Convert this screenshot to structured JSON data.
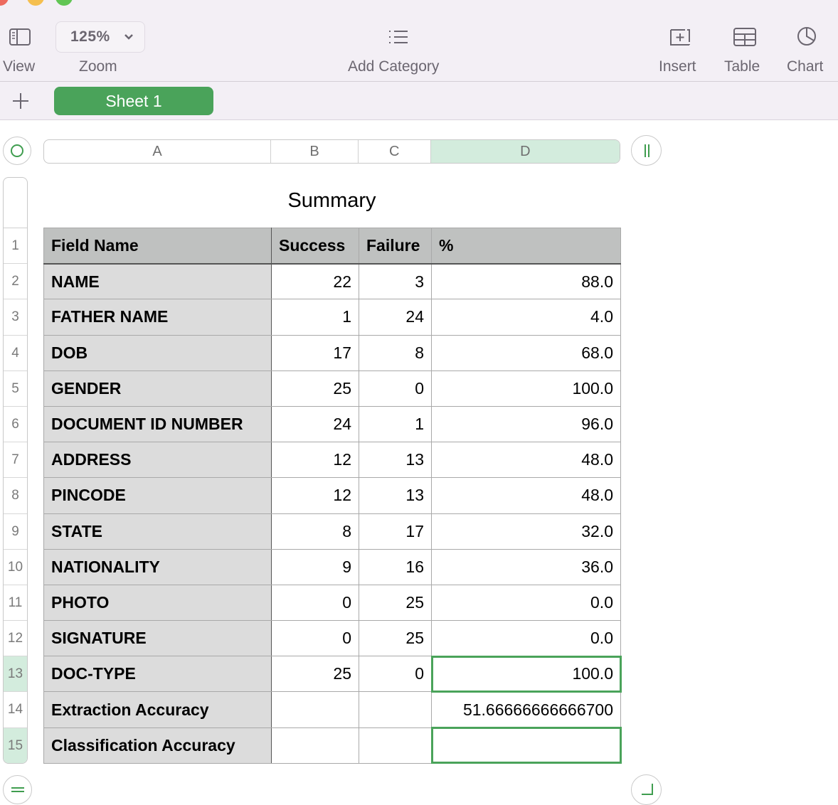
{
  "toolbar": {
    "view_label": "View",
    "zoom_label": "Zoom",
    "zoom_value": "125%",
    "add_category_label": "Add Category",
    "insert_label": "Insert",
    "table_label": "Table",
    "chart_label": "Chart"
  },
  "sheets": {
    "add_label": "+",
    "tabs": [
      {
        "label": "Sheet 1",
        "active": true
      }
    ]
  },
  "columns": [
    "A",
    "B",
    "C",
    "D"
  ],
  "selected_column": "D",
  "rows": [
    "1",
    "2",
    "3",
    "4",
    "5",
    "6",
    "7",
    "8",
    "9",
    "10",
    "11",
    "12",
    "13",
    "14",
    "15"
  ],
  "selected_rows": [
    "13",
    "15"
  ],
  "table": {
    "title": "Summary",
    "headers": [
      "Field Name",
      "Success",
      "Failure",
      "%"
    ],
    "body": [
      {
        "name": "NAME",
        "success": "22",
        "failure": "3",
        "pct": "88.0"
      },
      {
        "name": "FATHER NAME",
        "success": "1",
        "failure": "24",
        "pct": "4.0"
      },
      {
        "name": "DOB",
        "success": "17",
        "failure": "8",
        "pct": "68.0"
      },
      {
        "name": "GENDER",
        "success": "25",
        "failure": "0",
        "pct": "100.0"
      },
      {
        "name": "DOCUMENT ID NUMBER",
        "success": "24",
        "failure": "1",
        "pct": "96.0"
      },
      {
        "name": "ADDRESS",
        "success": "12",
        "failure": "13",
        "pct": "48.0"
      },
      {
        "name": "PINCODE",
        "success": "12",
        "failure": "13",
        "pct": "48.0"
      },
      {
        "name": "STATE",
        "success": "8",
        "failure": "17",
        "pct": "32.0"
      },
      {
        "name": "NATIONALITY",
        "success": "9",
        "failure": "16",
        "pct": "36.0"
      },
      {
        "name": "PHOTO",
        "success": "0",
        "failure": "25",
        "pct": "0.0"
      },
      {
        "name": "SIGNATURE",
        "success": "0",
        "failure": "25",
        "pct": "0.0"
      },
      {
        "name": "DOC-TYPE",
        "success": "25",
        "failure": "0",
        "pct": "100.0"
      },
      {
        "name": "Extraction Accuracy",
        "success": "",
        "failure": "",
        "pct": "51.66666666666700"
      },
      {
        "name": "Classification Accuracy",
        "success": "",
        "failure": "",
        "pct": ""
      }
    ]
  },
  "colors": {
    "accent_green": "#4aa35a",
    "selection_fill": "#d3ecdd",
    "header_fill": "#bfc1c0",
    "name_col_fill": "#dcdcdc"
  }
}
